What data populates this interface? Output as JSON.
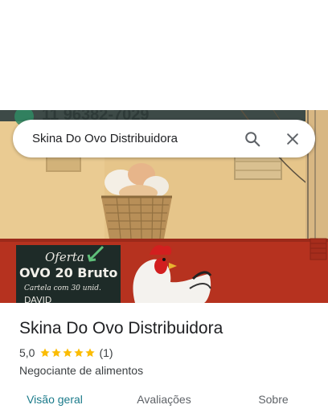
{
  "search": {
    "query": "Skina Do Ovo Distribuidora"
  },
  "hero_sign_text": "11 96382-7029",
  "chalkboard": {
    "line1": "Oferta",
    "line2": "OVO 20 Bruto",
    "line3": "Cartela com 30 unid.",
    "line4": "DAVID"
  },
  "place": {
    "title": "Skina Do Ovo Distribuidora",
    "rating": "5,0",
    "stars": 5,
    "review_count": "(1)",
    "category": "Negociante de alimentos"
  },
  "tabs": [
    {
      "label": "Visão geral",
      "active": true
    },
    {
      "label": "Avaliações",
      "active": false
    },
    {
      "label": "Sobre",
      "active": false
    }
  ],
  "colors": {
    "accent": "#1a7a8a",
    "star": "#fbbc04",
    "wall_yellow": "#e9c98f",
    "wall_red": "#b6321f"
  }
}
